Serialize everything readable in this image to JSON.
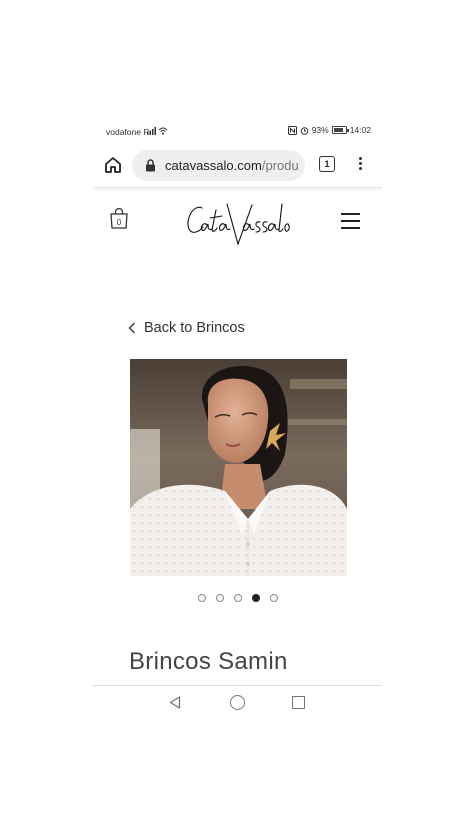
{
  "status_bar": {
    "carrier": "vodafone P",
    "battery": "93%",
    "time": "14:02"
  },
  "browser": {
    "url_host": "catavassalo.com",
    "url_path": "/produ",
    "tab_count": "1"
  },
  "site": {
    "cart_count": "0",
    "logo_text": "CataVassalo"
  },
  "product": {
    "back_label": "Back to Brincos",
    "title": "Brincos Samin",
    "gallery_total": 5,
    "gallery_active": 4
  },
  "colors": {
    "accent": "#222222",
    "url_bar": "#efefef"
  }
}
